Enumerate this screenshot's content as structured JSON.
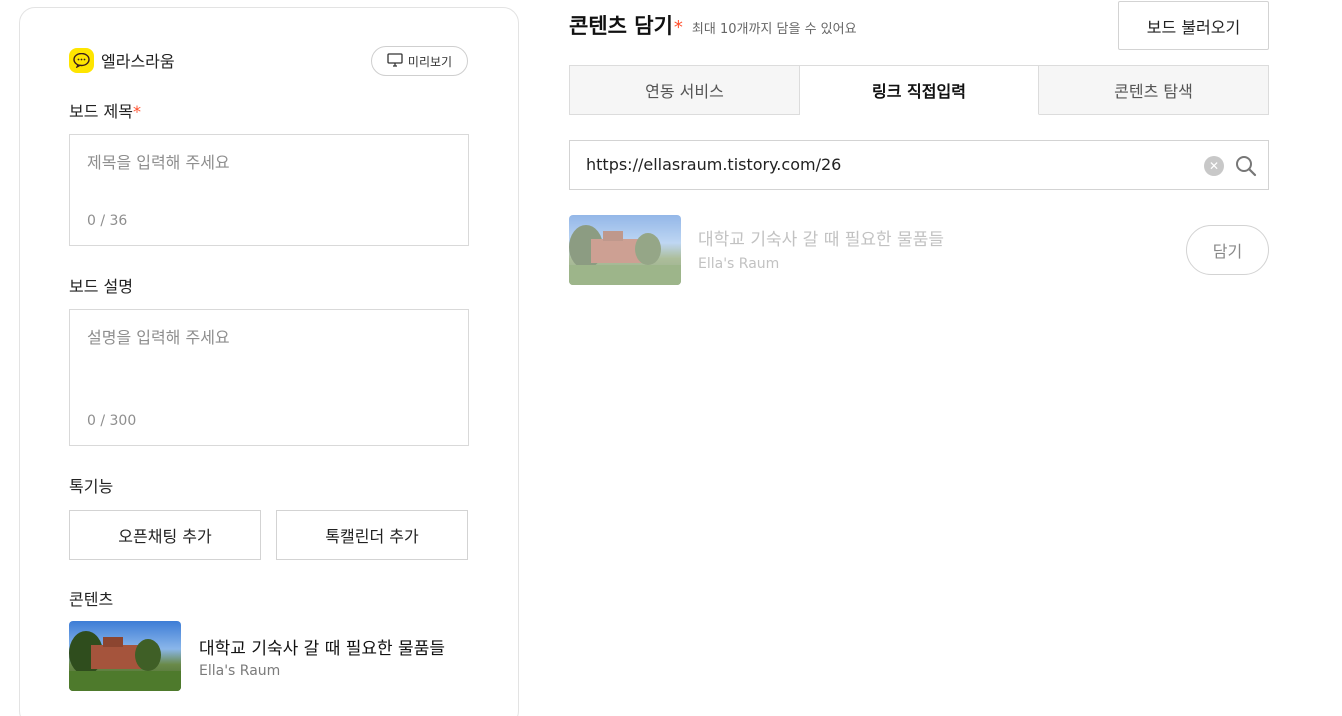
{
  "left": {
    "channel_name": "엘라스라움",
    "preview_button": "미리보기",
    "title_label": "보드 제목",
    "required_mark": "*",
    "title_placeholder": "제목을 입력해 주세요",
    "title_count": "0 / 36",
    "desc_label": "보드 설명",
    "desc_placeholder": "설명을 입력해 주세요",
    "desc_count": "0 / 300",
    "talk_label": "톡기능",
    "open_chat_button": "오픈채팅 추가",
    "talk_calendar_button": "톡캘린더 추가",
    "content_label": "콘텐츠",
    "content_item": {
      "title": "대학교 기숙사 갈 때 필요한 물품들",
      "source": "Ella's Raum"
    }
  },
  "right": {
    "title": "콘텐츠 담기",
    "required_mark": "*",
    "hint": "최대 10개까지 담을 수 있어요",
    "load_board_button": "보드 불러오기",
    "tabs": [
      {
        "label": "연동 서비스"
      },
      {
        "label": "링크 직접입력"
      },
      {
        "label": "콘텐츠 탐색"
      }
    ],
    "active_tab": "링크 직접입력",
    "url_value": "https://ellasraum.tistory.com/26",
    "result": {
      "title": "대학교 기숙사 갈 때 필요한 물품들",
      "source": "Ella's Raum",
      "add_button": "담기"
    }
  },
  "colors": {
    "kakao_yellow": "#fee500",
    "required": "#ff4e2b"
  },
  "icons": [
    "kakao-talk-icon",
    "monitor-icon",
    "clear-icon",
    "search-icon"
  ]
}
